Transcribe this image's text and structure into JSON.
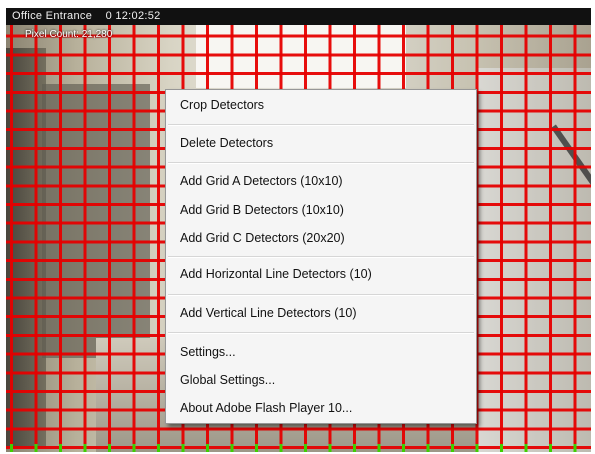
{
  "overlay": {
    "camera_title": "Office Entrance",
    "timestamp": "0 12:02:52",
    "pixel_count_label": "Pixel Count: 21,280"
  },
  "colors": {
    "grid": "#e60000",
    "grid_bottom_marks": "#3fd000",
    "menu_background": "#f5f5f5"
  },
  "context_menu": {
    "crop_detectors": "Crop Detectors",
    "delete_detectors": "Delete Detectors",
    "add_grid_a": "Add Grid A Detectors (10x10)",
    "add_grid_b": "Add Grid B Detectors (10x10)",
    "add_grid_c": "Add Grid C Detectors (20x20)",
    "add_horizontal": "Add Horizontal Line Detectors (10)",
    "add_vertical": "Add Vertical Line Detectors (10)",
    "settings": "Settings...",
    "global_settings": "Global Settings...",
    "about_flash": "About Adobe Flash Player 10..."
  }
}
